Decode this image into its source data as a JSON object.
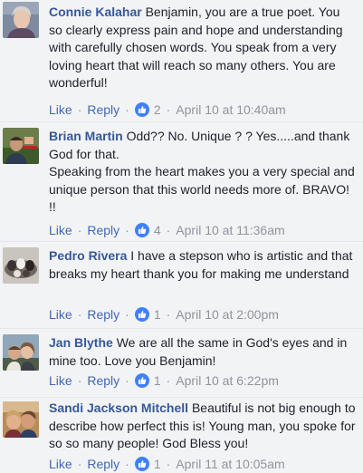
{
  "comments": [
    {
      "author": "Connie Kalahar",
      "text": "Benjamin, you are a true poet. You so clearly express pain and hope and understanding with carefully chosen words. You speak from a very loving heart that will reach so many others. You are wonderful!",
      "like": "Like",
      "reply": "Reply",
      "sep": "·",
      "reactions": "2",
      "time": "April 10 at 10:40am"
    },
    {
      "author": "Brian Martin",
      "text": "Odd?? No. Unique ? ? Yes.....and thank God for that.\nSpeaking from the heart makes you a very special and unique person that this world needs more of. BRAVO! !!",
      "like": "Like",
      "reply": "Reply",
      "sep": "·",
      "reactions": "4",
      "time": "April 10 at 11:36am"
    },
    {
      "author": "Pedro Rivera",
      "text": "I have a stepson who is artistic and that breaks my heart thank you for making me understand",
      "like": "Like",
      "reply": "Reply",
      "sep": "·",
      "reactions": "1",
      "time": "April 10 at 2:00pm"
    },
    {
      "author": "Jan Blythe",
      "text": "We are all the same in God's eyes and in mine too. Love you Benjamin!",
      "like": "Like",
      "reply": "Reply",
      "sep": "·",
      "reactions": "1",
      "time": "April 10 at 6:22pm"
    },
    {
      "author": "Sandi Jackson Mitchell",
      "text": "Beautiful is not big enough to describe how perfect this is! Young man, you spoke for so so many people! God Bless you!",
      "like": "Like",
      "reply": "Reply",
      "sep": "·",
      "reactions": "1",
      "time": "April 11 at 10:05am"
    }
  ]
}
